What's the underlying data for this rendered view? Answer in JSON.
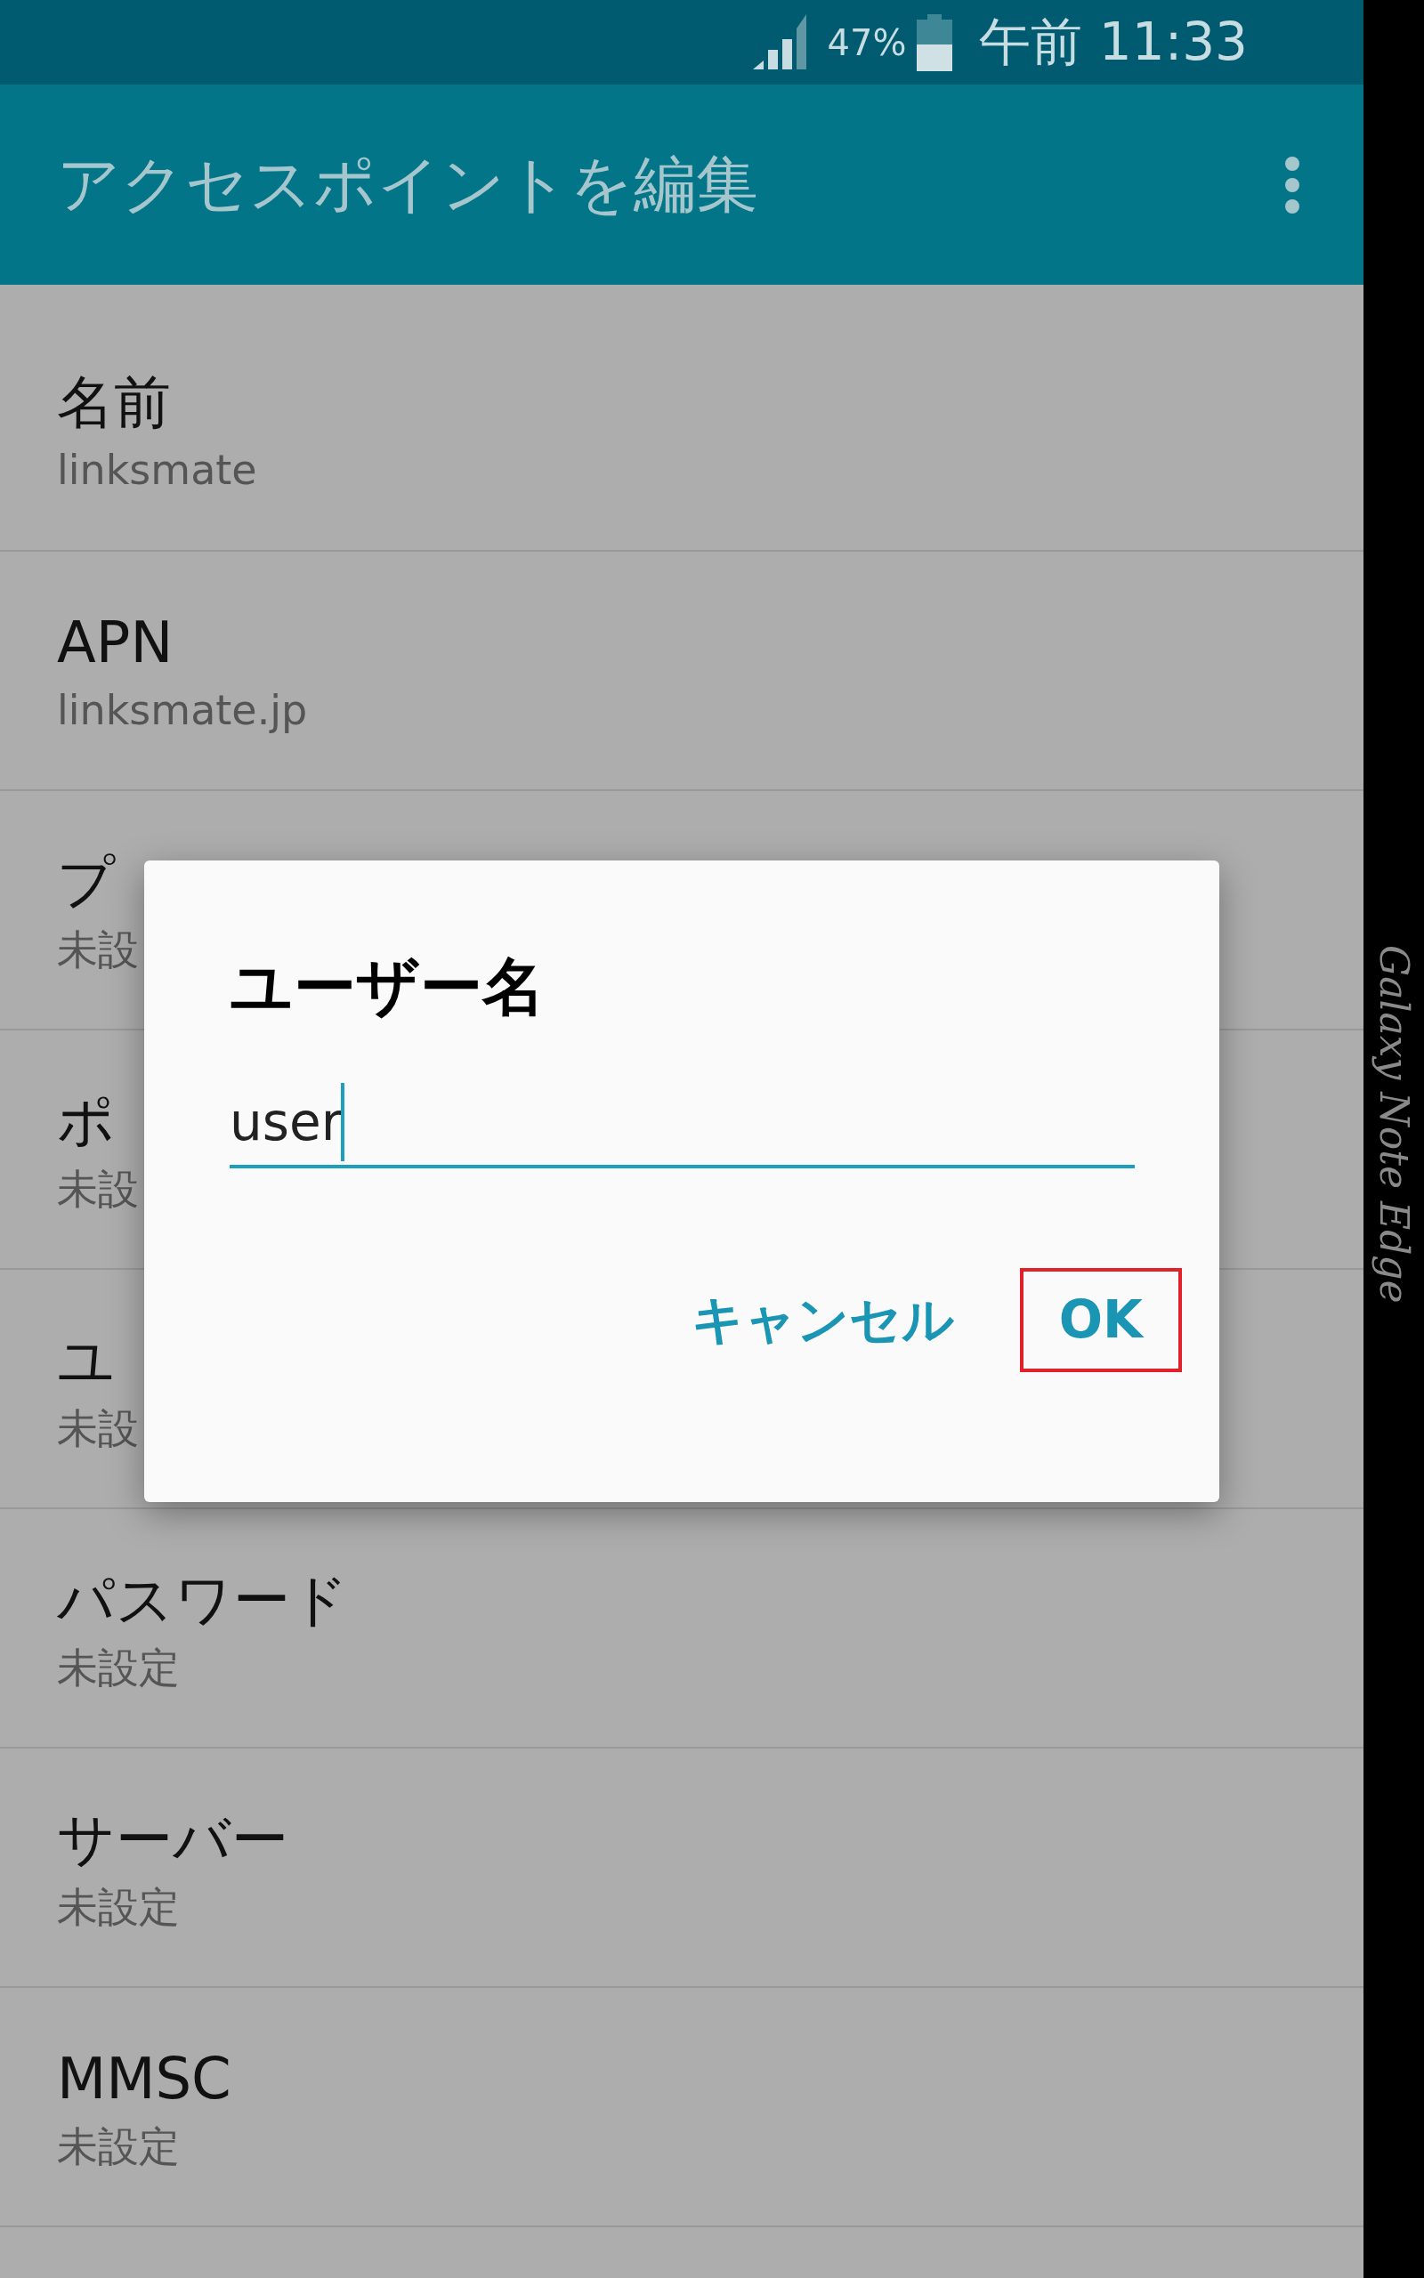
{
  "status_bar": {
    "battery": "47%",
    "time": "午前 11:33"
  },
  "app_bar": {
    "title": "アクセスポイントを編集"
  },
  "settings": [
    {
      "title": "名前",
      "value": "linksmate"
    },
    {
      "title": "APN",
      "value": "linksmate.jp"
    },
    {
      "title": "プ",
      "value": "未設"
    },
    {
      "title": "ポ",
      "value": "未設"
    },
    {
      "title": "ユ",
      "value": "未設"
    },
    {
      "title": "パスワード",
      "value": "未設定"
    },
    {
      "title": "サーバー",
      "value": "未設定"
    },
    {
      "title": "MMSC",
      "value": "未設定"
    }
  ],
  "dialog": {
    "title": "ユーザー名",
    "input": {
      "value": "user"
    },
    "actions": [
      {
        "label": "キャンセル",
        "highlighted": false
      },
      {
        "label": "OK",
        "highlighted": true
      }
    ]
  },
  "edge_screen": {
    "text": "Galaxy Note Edge"
  }
}
